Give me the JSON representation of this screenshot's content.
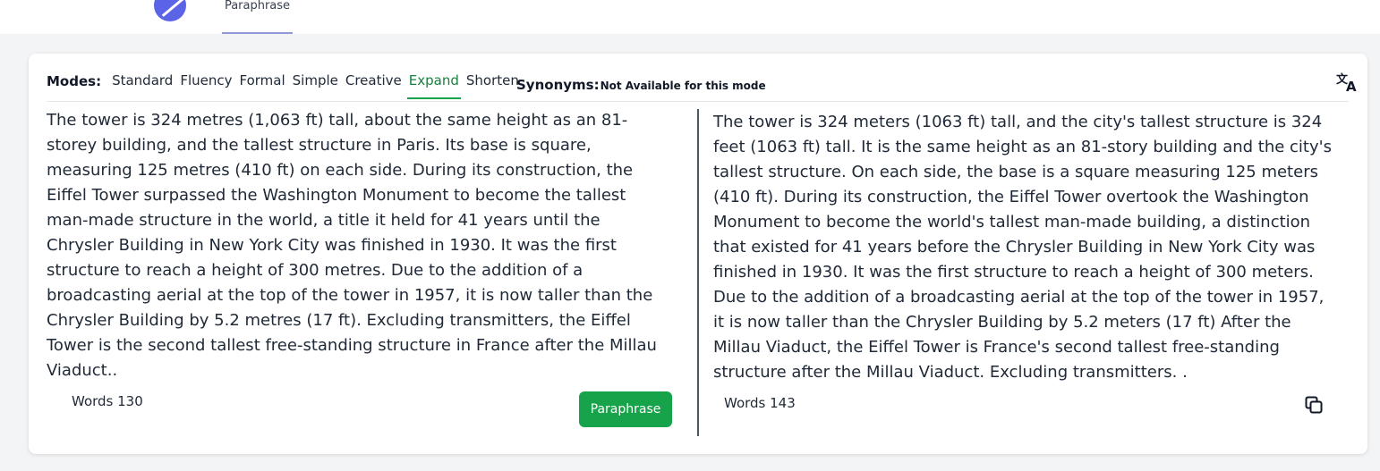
{
  "header": {
    "nav_tab_label": "Paraphrase"
  },
  "modes": {
    "label": "Modes:",
    "items": [
      "Standard",
      "Fluency",
      "Formal",
      "Simple",
      "Creative",
      "Expand",
      "Shorten"
    ],
    "active": "Expand"
  },
  "synonyms": {
    "label": "Synonyms:",
    "value": "Not Available for this mode"
  },
  "input": {
    "text": "The tower is 324 metres (1,063 ft) tall, about the same height as an 81-storey building, and the tallest structure in Paris. Its base is square, measuring 125 metres (410 ft) on each side. During its construction, the Eiffel Tower surpassed the Washington Monument to become the tallest man-made structure in the world, a title it held for 41 years until the Chrysler Building in New York City was finished in 1930. It was the first structure to reach a height of 300 metres. Due to the addition of a broadcasting aerial at the top of the tower in 1957, it is now taller than the Chrysler Building by 5.2 metres (17 ft). Excluding transmitters, the Eiffel Tower is the second tallest free-standing structure in France after the Millau Viaduct..",
    "word_count": "Words 130",
    "button_label": "Paraphrase"
  },
  "output": {
    "text": "The tower is 324 meters (1063 ft) tall, and the city's tallest structure is 324 feet (1063 ft) tall. It is the same height as an 81-story building and the city's tallest structure. On each side, the base is a square measuring 125 meters (410 ft). During its construction, the Eiffel Tower overtook the Washington Monument to become the world's tallest man-made building, a distinction that existed for 41 years before the Chrysler Building in New York City was finished in 1930. It was the first structure to reach a height of 300 meters. Due to the addition of a broadcasting aerial at the top of the tower in 1957, it is now taller than the Chrysler Building by 5.2 meters (17 ft) After the Millau Viaduct, the Eiffel Tower is France's second tallest free-standing structure after the Millau Viaduct. Excluding transmitters. .",
    "word_count": "Words 143"
  },
  "icons": {
    "logo": "app-logo",
    "translate": "translate-icon",
    "copy": "copy-icon"
  },
  "colors": {
    "accent_green": "#16a34a",
    "active_mode_text": "#16813d",
    "logo": "#5b63e6",
    "nav_underline": "#8e97d8"
  }
}
